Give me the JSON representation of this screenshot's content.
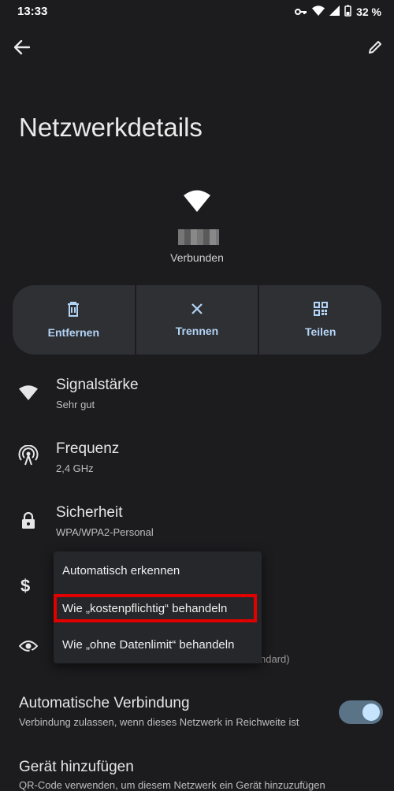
{
  "status_bar": {
    "time": "13:33",
    "battery": "32 %"
  },
  "header": {
    "title": "Netzwerkdetails"
  },
  "network": {
    "status": "Verbunden"
  },
  "actions": [
    {
      "label": "Entfernen",
      "icon": "trash-icon"
    },
    {
      "label": "Trennen",
      "icon": "close-icon"
    },
    {
      "label": "Teilen",
      "icon": "qr-code-icon"
    }
  ],
  "details": [
    {
      "title": "Signalstärke",
      "sub": "Sehr gut",
      "icon": "wifi-icon"
    },
    {
      "title": "Frequenz",
      "sub": "2,4 GHz",
      "icon": "antenna-icon"
    },
    {
      "title": "Sicherheit",
      "sub": "WPA/WPA2-Personal",
      "icon": "lock-icon"
    }
  ],
  "background_peek": {
    "standard_suffix": "ndard)",
    "qr_text": "QR-Code verwenden, um diesem Netzwerk ein Gerät hinzuzufügen"
  },
  "menu": {
    "items": [
      "Automatisch erkennen",
      "Wie „kostenpflichtig“ behandeln",
      "Wie „ohne Datenlimit“ behandeln"
    ]
  },
  "auto_connect": {
    "title": "Automatische Verbindung",
    "sub": "Verbindung zulassen, wenn dieses Netzwerk in Reichweite ist",
    "enabled": true
  },
  "add_device": {
    "title": "Gerät hinzufügen"
  },
  "colors": {
    "background": "#1c1c1e",
    "accent": "#b4d4f5",
    "highlight": "#e10000"
  }
}
